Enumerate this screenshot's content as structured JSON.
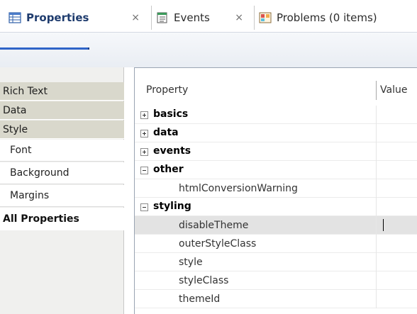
{
  "tabs": [
    {
      "label": "Properties",
      "close": "×",
      "icon": "properties-grid-icon",
      "active": true
    },
    {
      "label": "Events",
      "close": "×",
      "icon": "events-list-icon",
      "active": false
    },
    {
      "label": "Problems (0 items)",
      "icon": "problems-icon",
      "active": false
    }
  ],
  "categories": {
    "rich_text": "Rich Text",
    "data": "Data",
    "style": "Style",
    "font": "Font",
    "background": "Background",
    "margins": "Margins",
    "all_properties": "All Properties"
  },
  "table": {
    "col_property": "Property",
    "col_value": "Value",
    "groups": {
      "basics": "basics",
      "data": "data",
      "events": "events",
      "other": "other",
      "styling": "styling"
    },
    "leaves": {
      "html_conversion_warning": "htmlConversionWarning",
      "disable_theme": "disableTheme",
      "outer_style_class": "outerStyleClass",
      "style": "style",
      "style_class": "styleClass",
      "theme_id": "themeId"
    }
  },
  "colors": {
    "accent": "#2f64c8",
    "category_bg": "#d9d8cc",
    "selected_row": "#e3e3e3"
  }
}
